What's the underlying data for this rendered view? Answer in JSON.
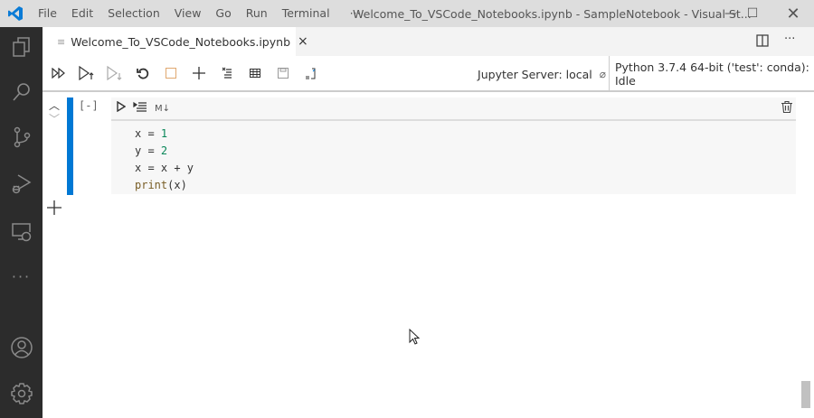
{
  "titlebar": {
    "menu": [
      "File",
      "Edit",
      "Selection",
      "View",
      "Go",
      "Run",
      "Terminal",
      "···"
    ],
    "title": "Welcome_To_VSCode_Notebooks.ipynb - SampleNotebook - Visual St..."
  },
  "tab": {
    "label": "Welcome_To_VSCode_Notebooks.ipynb",
    "close": "×"
  },
  "toolbar": {
    "server": "Jupyter Server: local",
    "kernel": "Python 3.7.4 64-bit ('test': conda): Idle"
  },
  "cell": {
    "execution_count": "[-]",
    "markdown_label": "M↓",
    "code": [
      [
        {
          "t": "x = ",
          "c": ""
        },
        {
          "t": "1",
          "c": "num"
        }
      ],
      [
        {
          "t": "y = ",
          "c": ""
        },
        {
          "t": "2",
          "c": "num"
        }
      ],
      [
        {
          "t": "x = x + y",
          "c": ""
        }
      ],
      [
        {
          "t": "print",
          "c": "fn"
        },
        {
          "t": "(x)",
          "c": ""
        }
      ]
    ]
  },
  "colors": {
    "accent": "#0078d4",
    "activity_bg": "#2c2c2c",
    "titlebar_bg": "#dddddd"
  }
}
